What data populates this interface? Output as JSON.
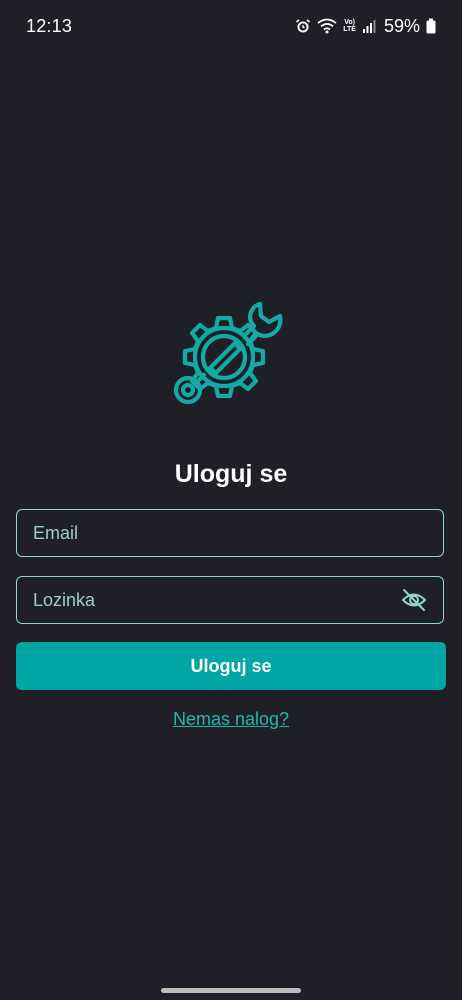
{
  "status_bar": {
    "time": "12:13",
    "volte_top": "Vo)",
    "volte_bottom": "LTE",
    "battery": "59%",
    "icons": [
      "alarm-icon",
      "wifi-icon",
      "volte-icon",
      "signal-icon",
      "battery-icon"
    ]
  },
  "logo": {
    "icon": "gear-wrench-icon",
    "color": "#13aaa6"
  },
  "login": {
    "title": "Uloguj se",
    "email_placeholder": "Email",
    "email_value": "",
    "password_placeholder": "Lozinka",
    "password_value": "",
    "password_toggle_icon": "eye-off-icon",
    "submit_label": "Uloguj se",
    "register_link": "Nemas nalog?"
  },
  "colors": {
    "background": "#1f1f27",
    "accent": "#00a6a3",
    "field_border": "#8fd6cf",
    "link": "#1fb8b0"
  }
}
